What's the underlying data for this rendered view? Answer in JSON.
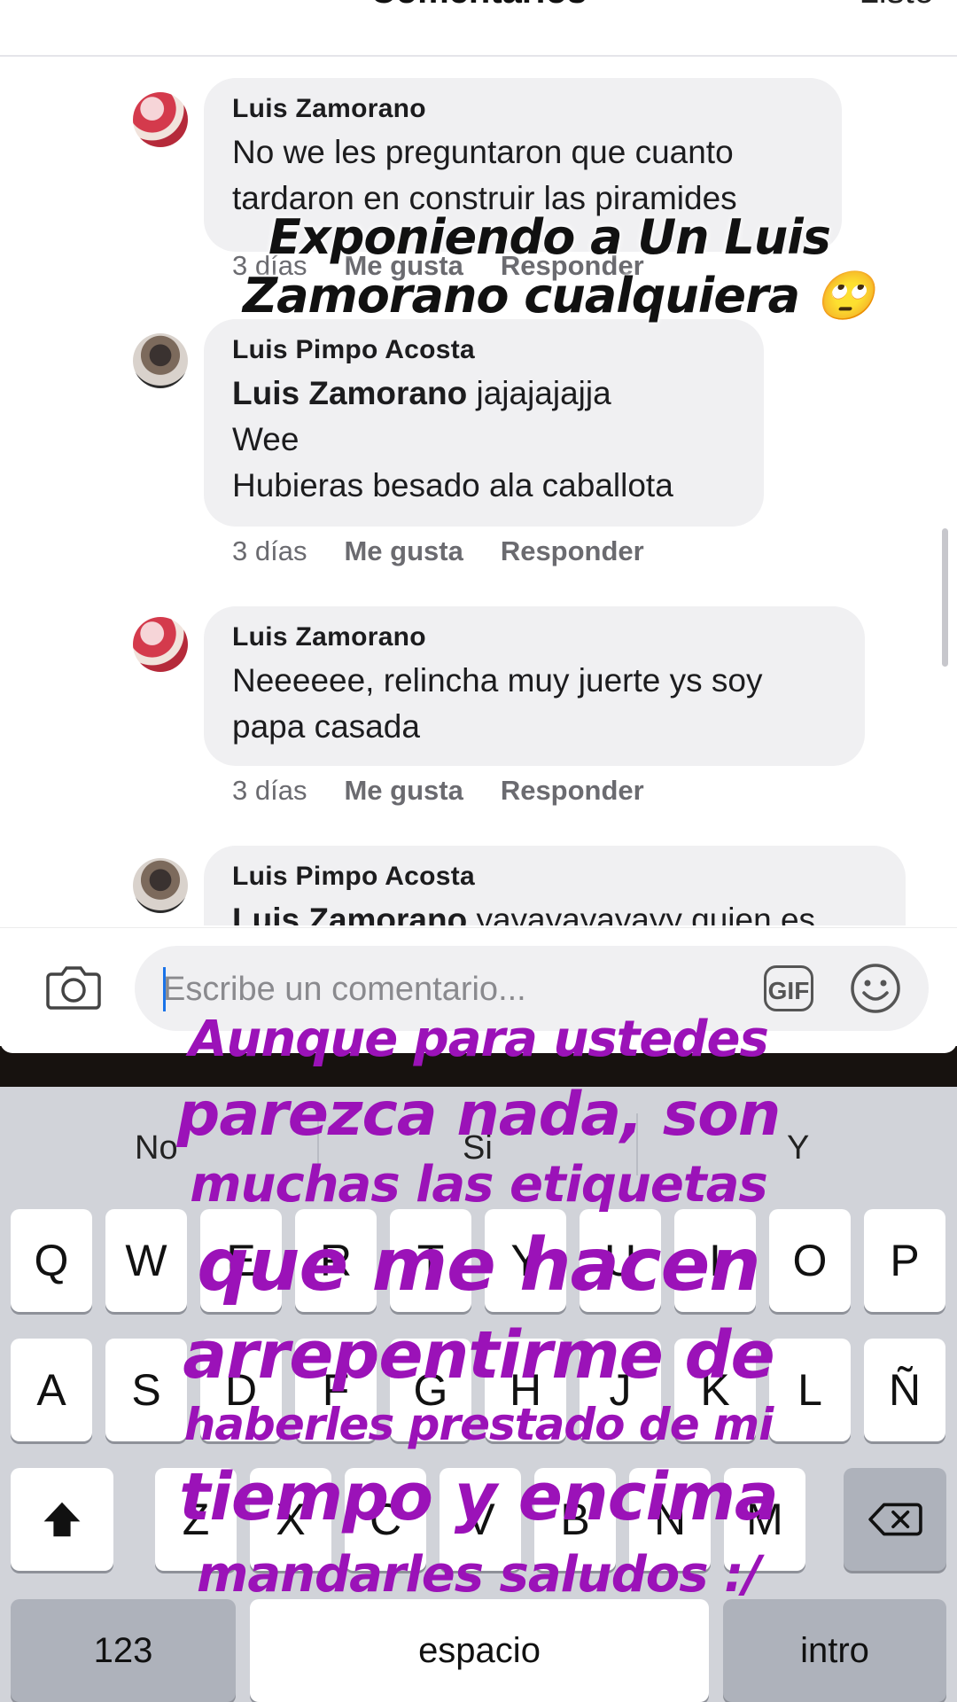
{
  "header": {
    "title": "Comentarios",
    "done": "Listo"
  },
  "comments": [
    {
      "author": "Luis Zamorano",
      "mention": "",
      "lines": [
        "No we les preguntaron que cuanto",
        "tardaron en construir las piramides"
      ],
      "time": "3 días",
      "like": "Me gusta",
      "reply": "Responder",
      "avatar": "avatar-red"
    },
    {
      "author": "Luis Pimpo Acosta",
      "mention": "Luis Zamorano",
      "lines": [
        " jajajajajja",
        "Wee",
        "Hubieras besado ala caballota"
      ],
      "time": "3 días",
      "like": "Me gusta",
      "reply": "Responder",
      "avatar": "avatar-dark"
    },
    {
      "author": "Luis Zamorano",
      "mention": "",
      "lines": [
        "Neeeeee, relincha muy juerte ys soy",
        "papa casada"
      ],
      "time": "3 días",
      "like": "Me gusta",
      "reply": "Responder",
      "avatar": "avatar-red"
    },
    {
      "author": "Luis Pimpo Acosta",
      "mention": "Luis Zamorano",
      "lines": [
        " yayayayayayy quien es"
      ],
      "time": "",
      "like": "",
      "reply": "",
      "avatar": "avatar-dark"
    }
  ],
  "input": {
    "placeholder": "Escribe un comentario...",
    "gif": "GIF"
  },
  "keyboard": {
    "suggestions": [
      "No",
      "Si",
      "Y"
    ],
    "row1": [
      "Q",
      "W",
      "E",
      "R",
      "T",
      "Y",
      "U",
      "I",
      "O",
      "P"
    ],
    "row2": [
      "A",
      "S",
      "D",
      "F",
      "G",
      "H",
      "J",
      "K",
      "L",
      "Ñ"
    ],
    "row3": [
      "Z",
      "X",
      "C",
      "V",
      "B",
      "N",
      "M"
    ],
    "numbers": "123",
    "space": "espacio",
    "return": "intro"
  },
  "overlay": {
    "top_line1": "Exponiendo a Un Luis",
    "top_line2": "Zamorano cualquiera 🙄",
    "lines": [
      "Aunque para ustedes",
      "parezca nada, son",
      "muchas las etiquetas",
      "que me hacen",
      "arrepentirme de",
      "haberles prestado de mi",
      "tiempo y encima",
      "mandarles saludos :/"
    ],
    "color": "#9b12b8"
  }
}
